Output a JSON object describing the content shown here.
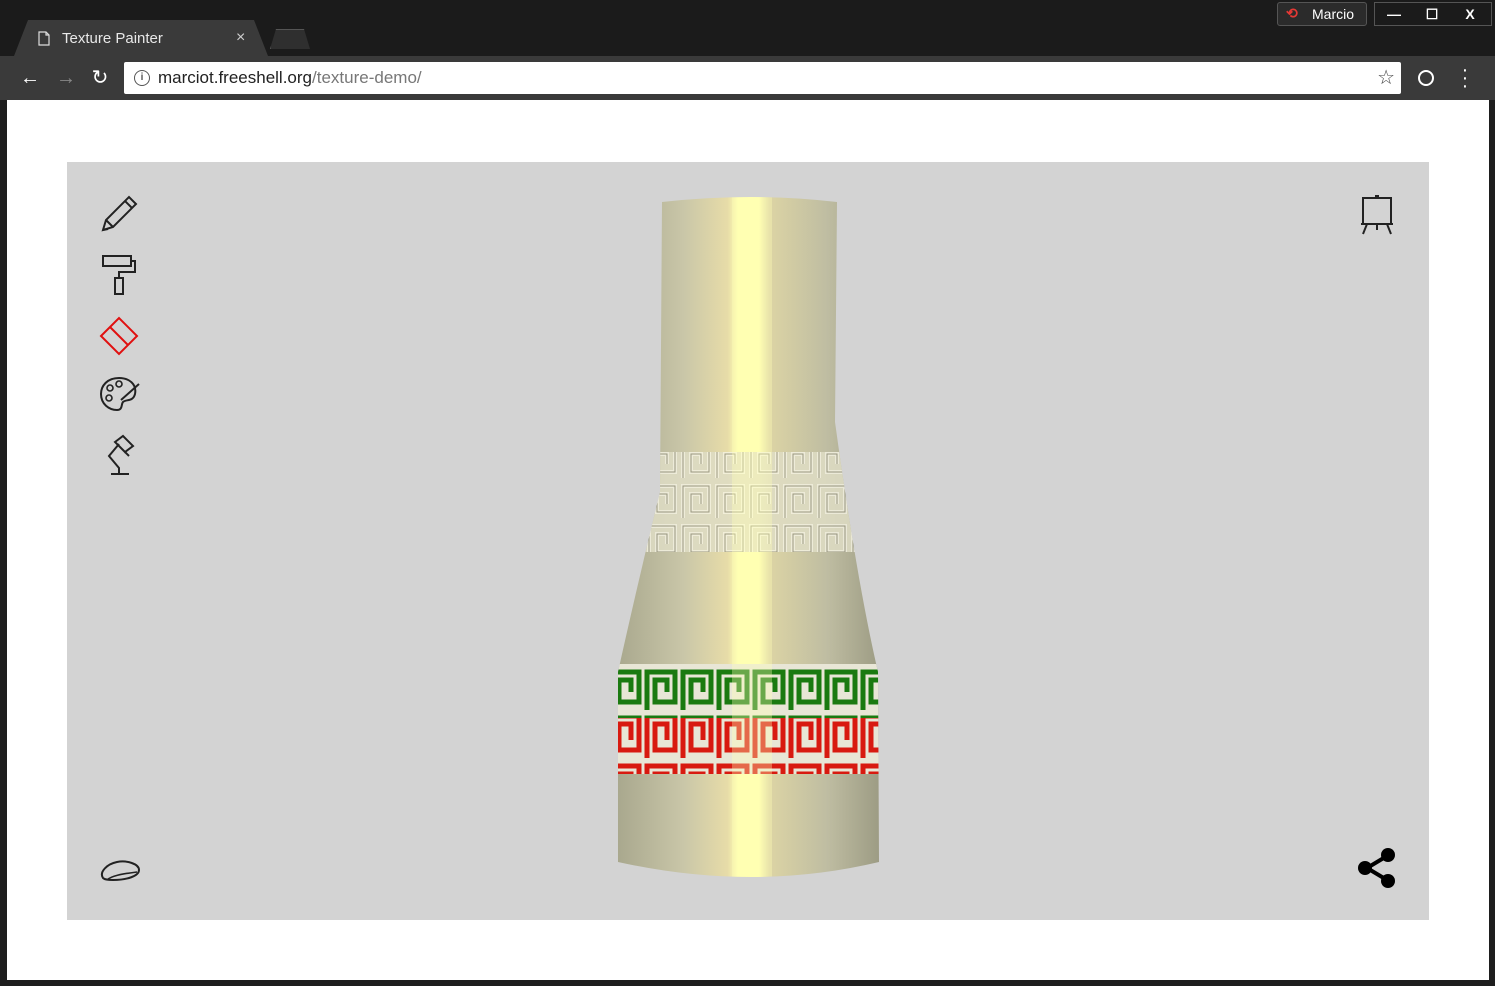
{
  "browser": {
    "tab_title": "Texture Painter",
    "tab_close": "×",
    "profile_name": "Marcio",
    "url_host": "marciot.freeshell.org",
    "url_path": "/texture-demo/",
    "window_buttons": {
      "minimize": "—",
      "maximize": "☐",
      "close": "X"
    }
  },
  "canvas": {
    "background": "#d3d3d3",
    "selected_tool": "eraser",
    "selected_color": "#e01010",
    "tools": [
      {
        "id": "pencil",
        "icon": "pencil-icon"
      },
      {
        "id": "roller",
        "icon": "paint-roller-icon"
      },
      {
        "id": "eraser",
        "icon": "eraser-icon"
      },
      {
        "id": "palette",
        "icon": "palette-icon"
      },
      {
        "id": "lamp",
        "icon": "desk-lamp-icon"
      }
    ],
    "top_right_tool": "easel-icon",
    "bottom_left_tool": "soap-icon",
    "bottom_right_tool": "share-icon",
    "vase_bands": [
      {
        "color": "#e9e6d0",
        "label": "embossed-key-band-upper"
      },
      {
        "color": "#1a7a10",
        "label": "green-key-band"
      },
      {
        "color": "#d81a10",
        "label": "red-key-band"
      }
    ]
  }
}
